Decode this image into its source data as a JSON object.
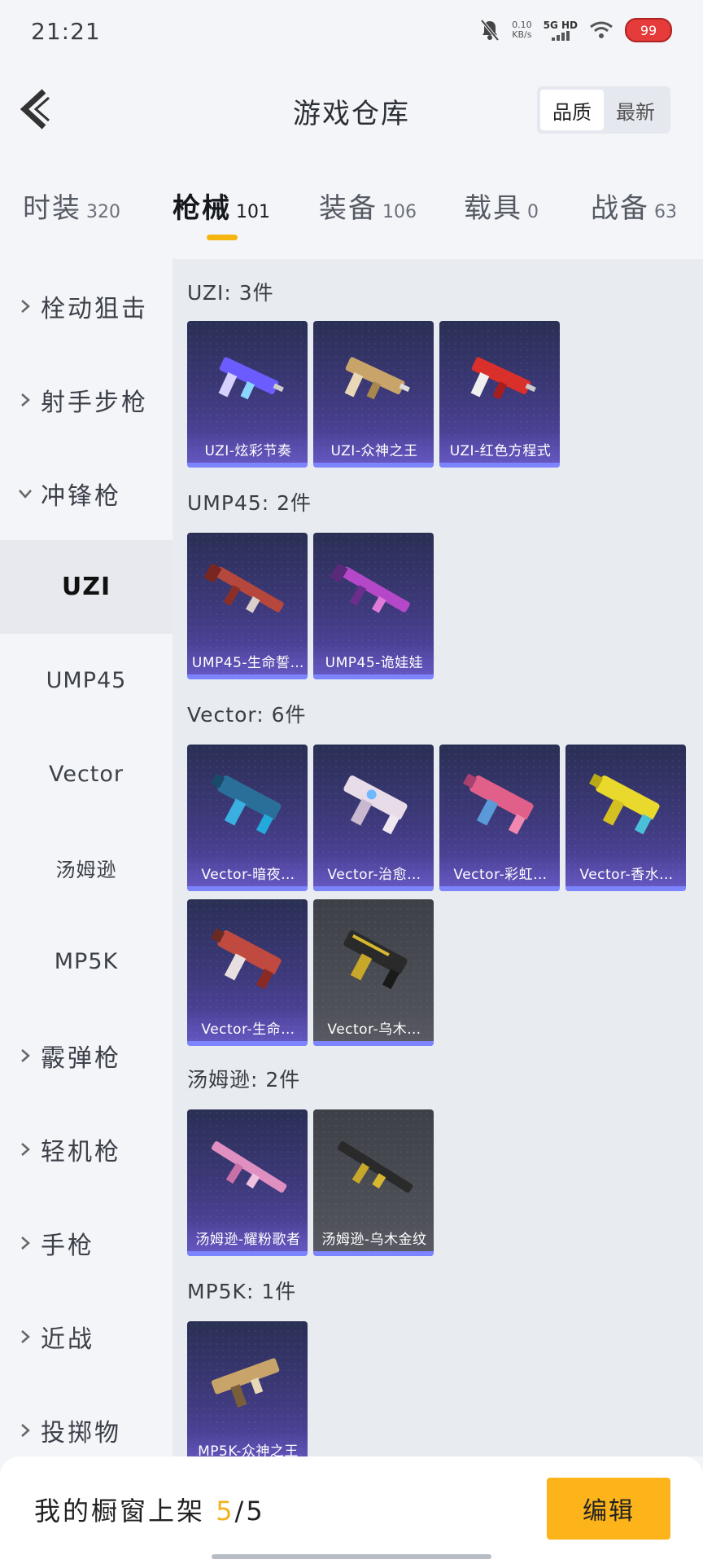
{
  "status_bar": {
    "time": "21:21",
    "net_speed": "0.10",
    "net_unit": "KB/s",
    "signal": "5G HD",
    "battery": "99"
  },
  "header": {
    "title": "游戏仓库",
    "sort_options": [
      "品质",
      "最新"
    ],
    "sort_active": "品质"
  },
  "tabs": [
    {
      "label": "时装",
      "count": "320"
    },
    {
      "label": "枪械",
      "count": "101"
    },
    {
      "label": "装备",
      "count": "106"
    },
    {
      "label": "载具",
      "count": "0"
    },
    {
      "label": "战备",
      "count": "63"
    }
  ],
  "sidebar": {
    "items": [
      {
        "label": "栓动狙击"
      },
      {
        "label": "射手步枪"
      },
      {
        "label": "冲锋枪"
      },
      {
        "label": "UZI"
      },
      {
        "label": "UMP45"
      },
      {
        "label": "Vector"
      },
      {
        "label": "汤姆逊"
      },
      {
        "label": "MP5K"
      },
      {
        "label": "霰弹枪"
      },
      {
        "label": "轻机枪"
      },
      {
        "label": "手枪"
      },
      {
        "label": "近战"
      },
      {
        "label": "投掷物"
      }
    ]
  },
  "groups": [
    {
      "title": "UZI: 3件",
      "items": [
        "UZI-炫彩节奏",
        "UZI-众神之王",
        "UZI-红色方程式"
      ]
    },
    {
      "title": "UMP45: 2件",
      "items": [
        "UMP45-生命誓…",
        "UMP45-诡娃娃"
      ]
    },
    {
      "title": "Vector: 6件",
      "items": [
        "Vector-暗夜…",
        "Vector-治愈…",
        "Vector-彩虹…",
        "Vector-香水…",
        "Vector-生命…",
        "Vector-乌木…"
      ]
    },
    {
      "title": "汤姆逊: 2件",
      "items": [
        "汤姆逊-耀粉歌者",
        "汤姆逊-乌木金纹"
      ]
    },
    {
      "title": "MP5K: 1件",
      "items": [
        "MP5K-众神之王"
      ]
    }
  ],
  "colors": {
    "accent": "#f6b40e",
    "card_purple": "#3f3a7e",
    "card_grey": "#4a4c54",
    "strip": "#7c84ff"
  },
  "bottom": {
    "label": "我的橱窗上架",
    "current": "5",
    "slash": "/",
    "total": "5",
    "edit": "编辑"
  }
}
